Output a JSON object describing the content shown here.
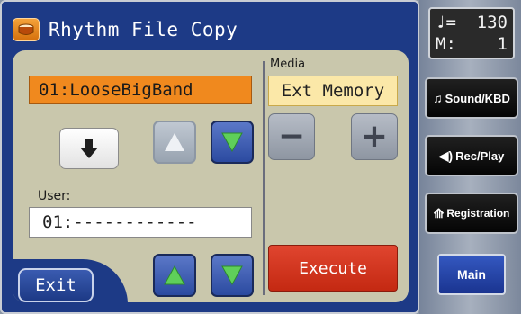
{
  "window": {
    "title": "Rhythm File Copy"
  },
  "source": {
    "pattern_value": "01:LooseBigBand"
  },
  "user": {
    "label": "User:",
    "value": "01:------------"
  },
  "media": {
    "label": "Media",
    "value": "Ext Memory"
  },
  "buttons": {
    "execute": "Execute",
    "exit": "Exit",
    "minus": "−",
    "plus": "+"
  },
  "lcd": {
    "tempo_symbol": "♩=",
    "tempo": "130",
    "measure_label": "M:",
    "measure": "1"
  },
  "side_buttons": {
    "sound_kbd": "Sound/KBD",
    "rec_play": "Rec/Play",
    "registration": "Registration",
    "main": "Main"
  },
  "icons": {
    "title": "rhythm-drum-icon",
    "sound_kbd": "music-note-icon",
    "rec_play": "speaker-icon",
    "registration": "music-book-icon"
  },
  "colors": {
    "accent_orange": "#f0891e",
    "media_field": "#fbe8a8",
    "execute_red": "#d8361f",
    "screen_navy": "#1d3a86",
    "panel_beige": "#c9c7ac",
    "arrow_green": "#5fcf5a"
  }
}
